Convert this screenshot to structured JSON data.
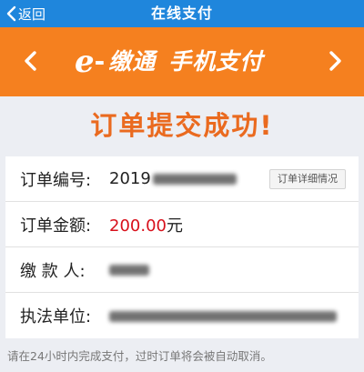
{
  "navbar": {
    "back_label": "返回",
    "title": "在线支付"
  },
  "banner": {
    "logo_e": "e",
    "logo_dash": "-",
    "logo_brand": "缴通",
    "logo_sub": "手机支付"
  },
  "success_title": "订单提交成功!",
  "order": {
    "number_label": "订单编号:",
    "number_value": "2019",
    "detail_button": "订单详细情况",
    "amount_label": "订单金额:",
    "amount_value": "200.00",
    "amount_unit": "元",
    "payer_label": "缴 款 人:",
    "unit_label": "执法单位:"
  },
  "footer_note": "请在24小时内完成支付，过时订单将会被自动取消。",
  "colors": {
    "navbar": "#1f86dc",
    "banner": "#f5801f",
    "success": "#ea6a1f",
    "amount": "#d8101b"
  }
}
